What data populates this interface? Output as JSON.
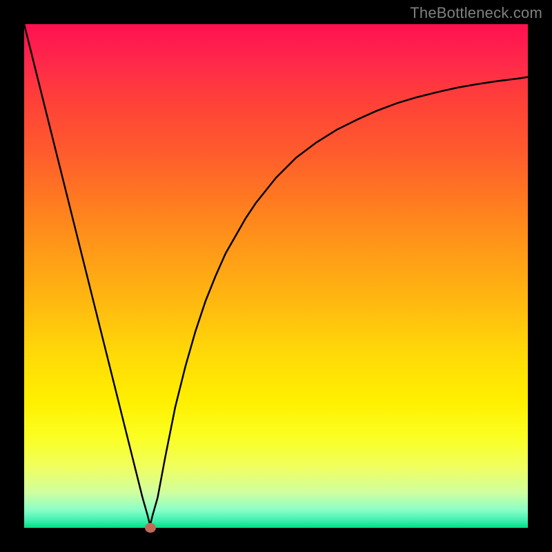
{
  "watermark": "TheBottleneck.com",
  "colors": {
    "frame": "#000000",
    "curve": "#000000",
    "dot": "#c26858",
    "gradient_top": "#ff1050",
    "gradient_bottom": "#00e080"
  },
  "chart_data": {
    "type": "line",
    "title": "",
    "xlabel": "",
    "ylabel": "",
    "xlim": [
      0,
      100
    ],
    "ylim": [
      0,
      100
    ],
    "annotations": [
      {
        "name": "minimum-point",
        "x": 25,
        "y": 0
      }
    ],
    "series": [
      {
        "name": "bottleneck-curve",
        "x": [
          0,
          2,
          4,
          6,
          8,
          10,
          12,
          14,
          16,
          18,
          20,
          22,
          23.5,
          24.5,
          25,
          25.5,
          26.5,
          28,
          30,
          32,
          34,
          36,
          38,
          40,
          42,
          44,
          46,
          48,
          50,
          54,
          58,
          62,
          66,
          70,
          74,
          78,
          82,
          86,
          90,
          94,
          98,
          100
        ],
        "values": [
          100,
          92,
          84,
          76,
          68,
          60,
          52,
          44,
          36,
          28,
          20,
          12,
          6,
          2.5,
          0.5,
          2.5,
          6,
          14,
          24,
          32,
          39,
          45,
          50,
          54.5,
          58,
          61.5,
          64.5,
          67,
          69.5,
          73.5,
          76.5,
          79,
          81,
          82.8,
          84.3,
          85.5,
          86.5,
          87.4,
          88.1,
          88.7,
          89.2,
          89.5
        ]
      }
    ]
  }
}
